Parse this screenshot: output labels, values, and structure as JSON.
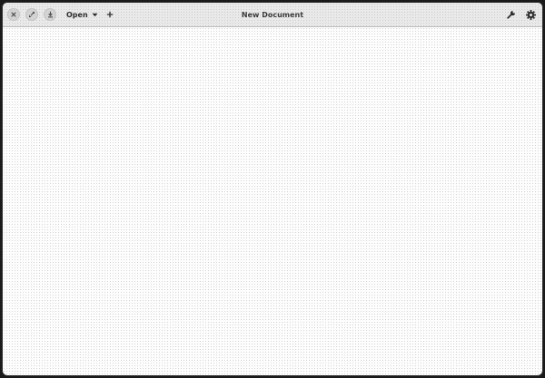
{
  "window": {
    "title": "New Document"
  },
  "headerbar": {
    "open_label": "Open",
    "icons": {
      "close": "close-icon",
      "maximize": "maximize-icon",
      "save": "download-icon",
      "open_dropdown": "chevron-down-icon",
      "new_tab": "plus-icon",
      "tools": "wrench-icon",
      "settings": "gear-icon"
    }
  },
  "editor": {
    "content": ""
  }
}
